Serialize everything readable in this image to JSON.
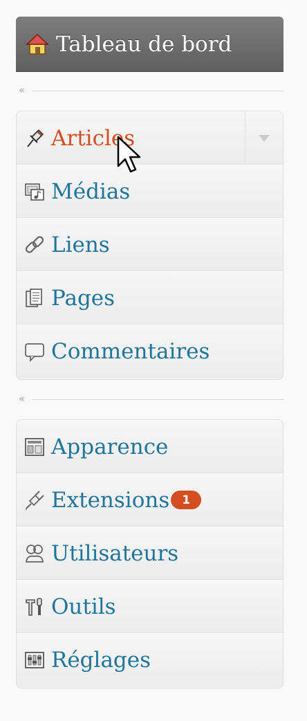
{
  "dashboard": {
    "label": "Tableau de bord",
    "icon": "home-icon"
  },
  "collapse_glyph": "«",
  "group1": [
    {
      "label": "Articles",
      "icon": "pushpin-icon",
      "active": true
    },
    {
      "label": "Médias",
      "icon": "media-icon"
    },
    {
      "label": "Liens",
      "icon": "link-icon"
    },
    {
      "label": "Pages",
      "icon": "pages-icon"
    },
    {
      "label": "Commentaires",
      "icon": "comment-icon"
    }
  ],
  "group2": [
    {
      "label": "Apparence",
      "icon": "appearance-icon"
    },
    {
      "label": "Extensions",
      "icon": "plugin-icon",
      "badge": "1"
    },
    {
      "label": "Utilisateurs",
      "icon": "users-icon"
    },
    {
      "label": "Outils",
      "icon": "tools-icon"
    },
    {
      "label": "Réglages",
      "icon": "settings-icon"
    }
  ],
  "colors": {
    "link": "#21759b",
    "active": "#d54e21",
    "badge": "#d54e21"
  }
}
